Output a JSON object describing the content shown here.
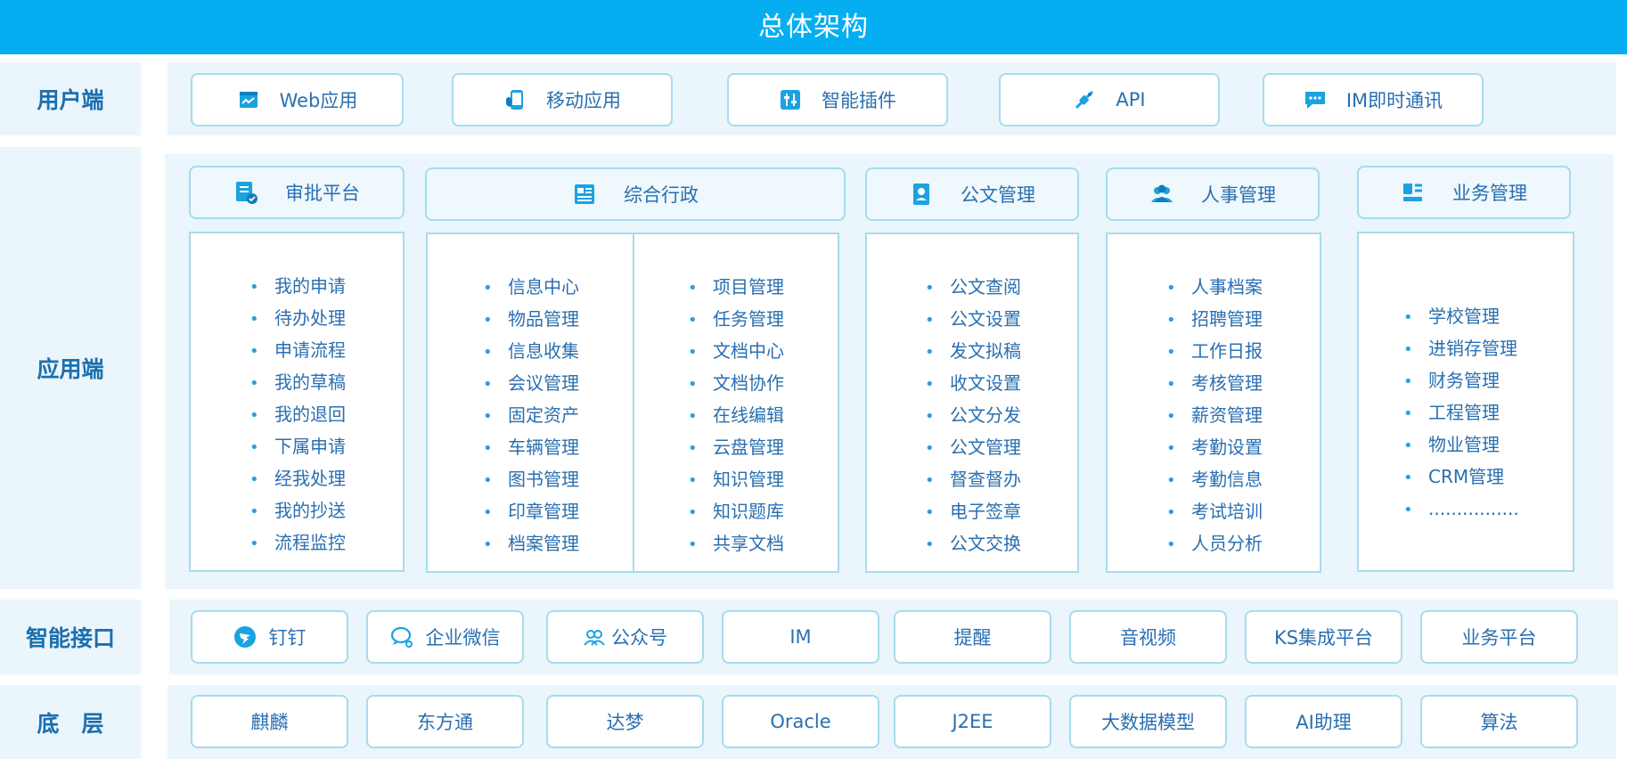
{
  "title": "总体架构",
  "rows": {
    "user": "用户端",
    "app": "应用端",
    "interface": "智能接口",
    "base": "底　层"
  },
  "user_items": [
    {
      "label": "Web应用",
      "icon": "web-app-icon"
    },
    {
      "label": "移动应用",
      "icon": "mobile-app-icon"
    },
    {
      "label": "智能插件",
      "icon": "plugin-icon"
    },
    {
      "label": "API",
      "icon": "api-plug-icon"
    },
    {
      "label": "IM即时通讯",
      "icon": "chat-icon"
    }
  ],
  "modules": [
    {
      "title": "审批平台",
      "icon": "approval-doc-icon",
      "items": [
        "我的申请",
        "待办处理",
        "申请流程",
        "我的草稿",
        "我的退回",
        "下属申请",
        "经我处理",
        "我的抄送",
        "流程监控"
      ]
    },
    {
      "title": "综合行政",
      "icon": "admin-news-icon",
      "items_left": [
        "信息中心",
        "物品管理",
        "信息收集",
        "会议管理",
        "固定资产",
        "车辆管理",
        "图书管理",
        "印章管理",
        "档案管理"
      ],
      "items_right": [
        "项目管理",
        "任务管理",
        "文档中心",
        "文档协作",
        "在线编辑",
        "云盘管理",
        "知识管理",
        "知识题库",
        "共享文档"
      ]
    },
    {
      "title": "公文管理",
      "icon": "document-badge-icon",
      "items": [
        "公文查阅",
        "公文设置",
        "发文拟稿",
        "收文设置",
        "公文分发",
        "公文管理",
        "督查督办",
        "电子签章",
        "公文交换"
      ]
    },
    {
      "title": "人事管理",
      "icon": "people-icon",
      "items": [
        "人事档案",
        "招聘管理",
        "工作日报",
        "考核管理",
        "薪资管理",
        "考勤设置",
        "考勤信息",
        "考试培训",
        "人员分析"
      ]
    },
    {
      "title": "业务管理",
      "icon": "business-list-icon",
      "items": [
        "学校管理",
        "进销存管理",
        "财务管理",
        "工程管理",
        "物业管理",
        "CRM管理",
        "................"
      ]
    }
  ],
  "interface_items": [
    {
      "label": "钉钉",
      "icon": "dingtalk-icon"
    },
    {
      "label": "企业微信",
      "icon": "wecom-icon"
    },
    {
      "label": "公众号",
      "icon": "official-account-icon"
    },
    {
      "label": "IM"
    },
    {
      "label": "提醒"
    },
    {
      "label": "音视频"
    },
    {
      "label": "KS集成平台"
    },
    {
      "label": "业务平台"
    }
  ],
  "base_items": [
    "麒麟",
    "东方通",
    "达梦",
    "Oracle",
    "J2EE",
    "大数据模型",
    "AI助理",
    "算法"
  ],
  "colors": {
    "title_bar": "#04aef0",
    "row_bg": "#eaf5fc",
    "border": "#a6dcee",
    "text": "#2a6fb0",
    "icon": "#1aa3e0"
  }
}
